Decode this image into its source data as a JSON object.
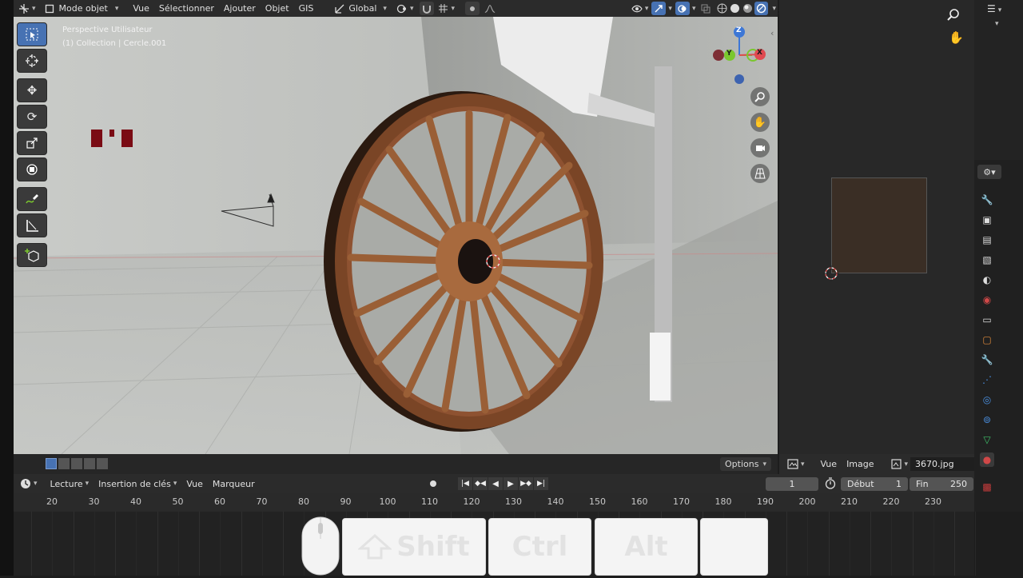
{
  "header": {
    "editor_type_icon": "axes-icon",
    "mode_label": "Mode objet",
    "menus": [
      "Vue",
      "Sélectionner",
      "Ajouter",
      "Objet",
      "GIS"
    ],
    "orientation_label": "Global"
  },
  "viewport": {
    "info_line1": "Perspective Utilisateur",
    "info_line2": "(1) Collection | Cercle.001",
    "gizmo_axes": {
      "z": "Z",
      "y": "Y",
      "x": "X"
    },
    "options_label": "Options",
    "tools": [
      "select-box-icon",
      "cursor-icon",
      "move-icon",
      "rotate-icon",
      "scale-icon",
      "transform-icon",
      "annotate-icon",
      "measure-icon",
      "add-cube-icon"
    ]
  },
  "image_editor": {
    "menus": [
      "Vue",
      "Image"
    ],
    "image_name": "3670.jpg"
  },
  "timeline": {
    "menus": [
      "Lecture",
      "Insertion de clés",
      "Vue",
      "Marqueur"
    ],
    "current_frame": "1",
    "start_label": "Début",
    "start_value": "1",
    "end_label": "Fin",
    "end_value": "250",
    "ruler_ticks": [
      "20",
      "30",
      "40",
      "50",
      "60",
      "70",
      "80",
      "90",
      "100",
      "110",
      "120",
      "130",
      "140",
      "150",
      "160",
      "170",
      "180",
      "190",
      "200",
      "210",
      "220",
      "230"
    ]
  },
  "keys_overlay": {
    "shift": "Shift",
    "ctrl": "Ctrl",
    "alt": "Alt"
  },
  "colors": {
    "accent": "#4772b3",
    "x_axis": "#e04a50",
    "y_axis": "#7ac72e",
    "z_axis": "#3d77d6",
    "wood": "#8a5433"
  }
}
